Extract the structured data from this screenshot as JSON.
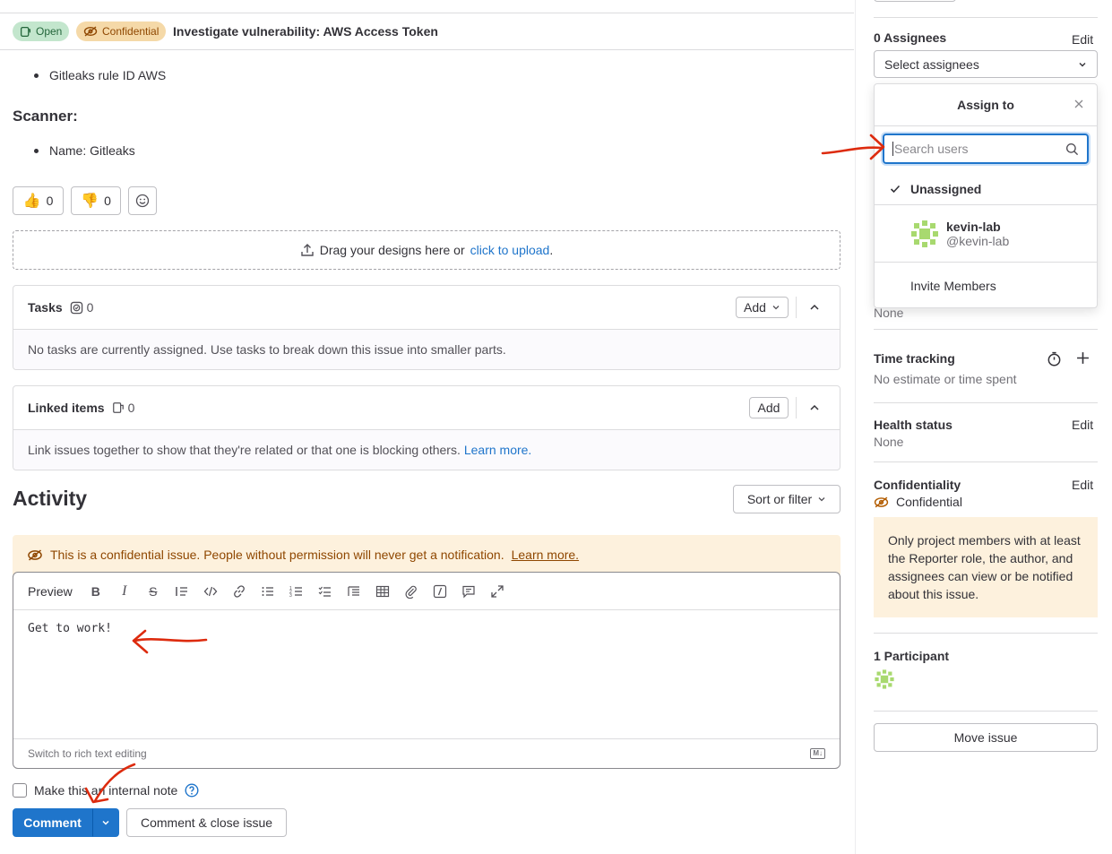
{
  "header": {
    "status_badge": "Open",
    "confidential_badge": "Confidential",
    "title": "Investigate vulnerability: AWS Access Token"
  },
  "description": {
    "rule_item": "Gitleaks rule ID AWS",
    "scanner_heading": "Scanner:",
    "scanner_item": "Name: Gitleaks"
  },
  "reactions": {
    "thumbs_up_count": "0",
    "thumbs_down_count": "0"
  },
  "designs": {
    "drop_text": "Drag your designs here or",
    "upload_link": "click to upload",
    "period": "."
  },
  "tasks": {
    "title": "Tasks",
    "count": "0",
    "add_label": "Add",
    "empty_text": "No tasks are currently assigned. Use tasks to break down this issue into smaller parts."
  },
  "linked_items": {
    "title": "Linked items",
    "count": "0",
    "add_label": "Add",
    "empty_text": "Link issues together to show that they're related or that one is blocking others.",
    "learn_more": "Learn more."
  },
  "activity": {
    "heading": "Activity",
    "sort_label": "Sort or filter",
    "warning_text": "This is a confidential issue. People without permission will never get a notification.",
    "warning_link": "Learn more."
  },
  "editor": {
    "preview_tab": "Preview",
    "content": "Get to work!",
    "switch_label": "Switch to rich text editing",
    "markdown_badge": "M↓"
  },
  "comment_form": {
    "internal_note_label": "Make this an internal note",
    "comment_button": "Comment",
    "close_button": "Comment & close issue"
  },
  "sidebar": {
    "assignees_label": "0 Assignees",
    "edit": "Edit",
    "select_assignees": "Select assignees",
    "dropdown": {
      "title": "Assign to",
      "search_placeholder": "Search users",
      "unassigned": "Unassigned",
      "user_name": "kevin-lab",
      "user_handle": "@kevin-lab",
      "invite": "Invite Members"
    },
    "partial_none": "None",
    "time_tracking_label": "Time tracking",
    "time_tracking_value": "No estimate or time spent",
    "health_label": "Health status",
    "health_value": "None",
    "confidentiality_label": "Confidentiality",
    "confidentiality_value": "Confidential",
    "confidentiality_note": "Only project members with at least the Reporter role, the author, and assignees can view or be notified about this issue.",
    "participants_label": "1 Participant",
    "move_issue": "Move issue"
  },
  "colors": {
    "accent": "#1f75cb",
    "annotation": "#dd2b0e",
    "warning_bg": "#fdf1dd",
    "avatar": "#a8d96f"
  }
}
